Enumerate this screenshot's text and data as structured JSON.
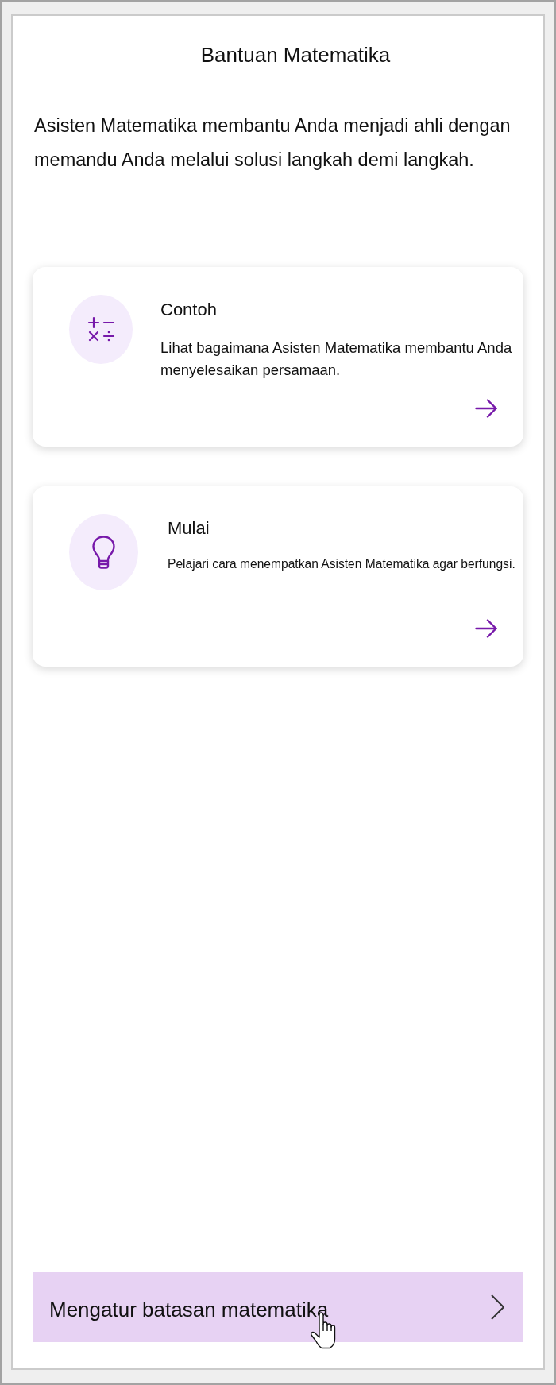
{
  "title": "Bantuan Matematika",
  "description": "Asisten Matematika membantu Anda menjadi ahli dengan memandu Anda melalui solusi langkah demi langkah.",
  "cards": [
    {
      "title": "Contoh",
      "description": "Lihat bagaimana Asisten Matematika membantu Anda menyelesaikan persamaan."
    },
    {
      "title": "Mulai",
      "description": "Pelajari cara menempatkan Asisten Matematika agar berfungsi."
    }
  ],
  "settings_button": {
    "label": "Mengatur batasan matematika",
    "hovered": true
  }
}
